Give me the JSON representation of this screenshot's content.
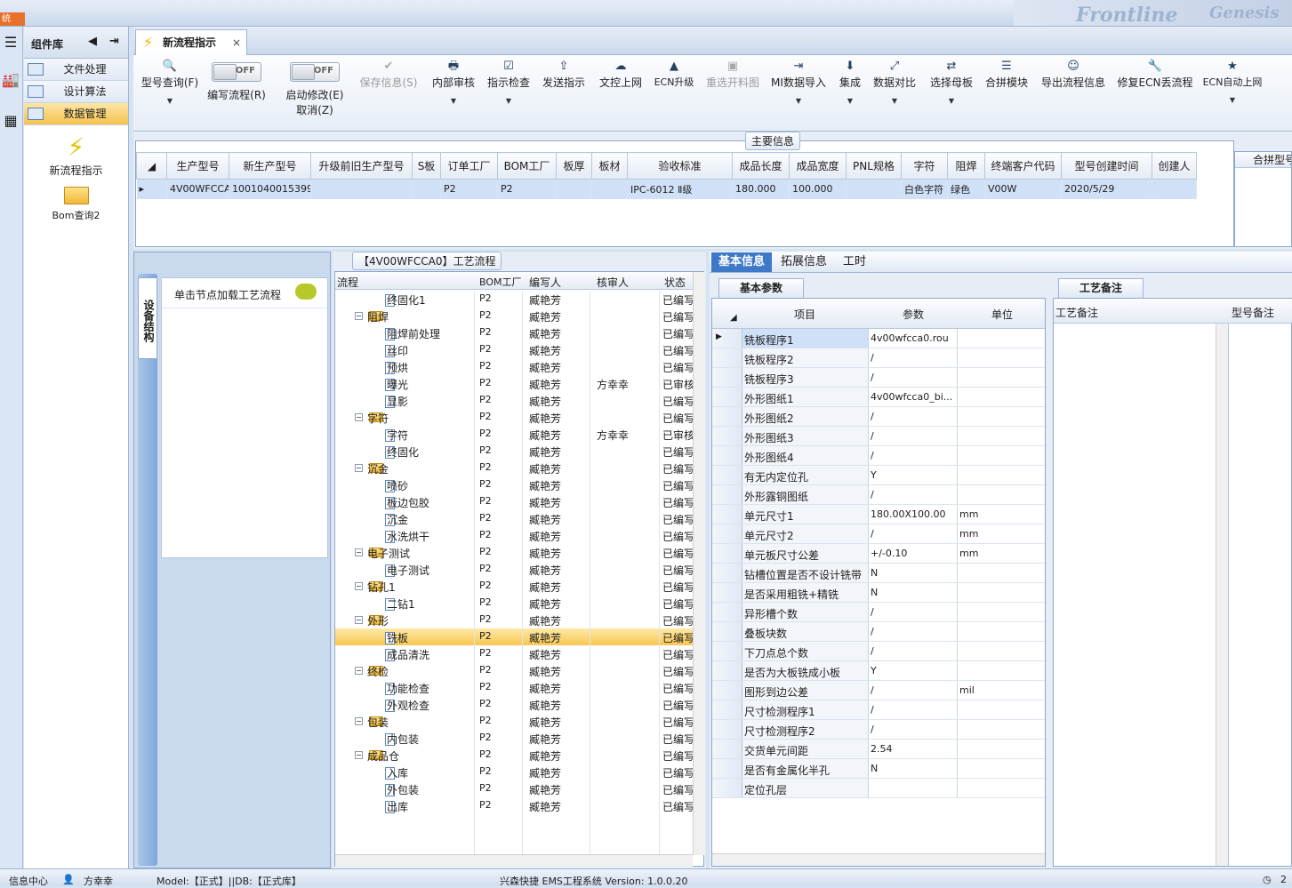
{
  "topbar": {
    "corner_label": "统",
    "brand_text": "Frontline",
    "brand_text2": "Genesis"
  },
  "sidebar": {
    "title": "组件库",
    "items": [
      {
        "label": "文件处理"
      },
      {
        "label": "设计算法"
      },
      {
        "label": "数据管理"
      }
    ],
    "tiles": [
      {
        "label": "新流程指示"
      },
      {
        "label": "Bom查询2"
      }
    ]
  },
  "tab": {
    "label": "新流程指示",
    "close": "×"
  },
  "toolbar": {
    "toggle_off": "OFF",
    "buttons": [
      {
        "label": "型号查询(F)",
        "icon": "search-icon",
        "glyph": "🔍"
      },
      {
        "label": "编写流程(R)"
      },
      {
        "label": "启动修改(E)",
        "label2": "取消(Z)"
      },
      {
        "label": "保存信息(S)",
        "glyph": "✔"
      },
      {
        "label": "内部审核",
        "glyph": "🖶"
      },
      {
        "label": "指示检查",
        "glyph": "☑"
      },
      {
        "label": "发送指示",
        "glyph": "⇪"
      },
      {
        "label": "文控上网",
        "glyph": "☁"
      },
      {
        "label": "ECN升级",
        "glyph": "▲"
      },
      {
        "label": "重选开料图",
        "glyph": "▣"
      },
      {
        "label": "MI数据导入",
        "glyph": "⇥"
      },
      {
        "label": "集成",
        "glyph": "⬇"
      },
      {
        "label": "数据对比",
        "glyph": "⤢"
      },
      {
        "label": "选择母板",
        "glyph": "⇄"
      },
      {
        "label": "合拼模块",
        "glyph": "☰"
      },
      {
        "label": "导出流程信息",
        "glyph": "☺"
      },
      {
        "label": "修复ECN丢流程",
        "glyph": "🔧"
      },
      {
        "label": "ECN自动上网",
        "glyph": "★"
      }
    ]
  },
  "main_info": {
    "group_title": "主要信息",
    "right_title": "合拼型号",
    "columns": [
      "生产型号",
      "新生产型号",
      "升级前旧生产型号",
      "S板",
      "订单工厂",
      "BOM工厂",
      "板厚",
      "板材",
      "验收标准",
      "成品长度",
      "成品宽度",
      "PNL规格",
      "字符",
      "阻焊",
      "终端客户代码",
      "型号创建时间",
      "创建人"
    ],
    "row": [
      "4V00WFCCA0",
      "10010400153993",
      "",
      "",
      "P2",
      "P2",
      "",
      "",
      "IPC-6012 Ⅱ级",
      "180.000",
      "100.000",
      "",
      "白色字符",
      "绿色",
      "V00W",
      "2020/5/29",
      ""
    ]
  },
  "side_tab": {
    "label": "设备结构",
    "hint": "单击节点加载工艺流程"
  },
  "flow": {
    "title": "【4V00WFCCA0】工艺流程",
    "columns": [
      "流程",
      "BOM工厂",
      "编写人",
      "核审人",
      "状态"
    ],
    "rows": [
      {
        "name": "终固化1",
        "level": 2,
        "factory": "P2",
        "writer": "臧艳芳",
        "reviewer": "",
        "status": "已编写"
      },
      {
        "name": "阻焊",
        "level": 1,
        "factory": "P2",
        "writer": "臧艳芳",
        "reviewer": "",
        "status": "已编写"
      },
      {
        "name": "阻焊前处理",
        "level": 2,
        "factory": "P2",
        "writer": "臧艳芳",
        "reviewer": "",
        "status": "已编写"
      },
      {
        "name": "丝印",
        "level": 2,
        "factory": "P2",
        "writer": "臧艳芳",
        "reviewer": "",
        "status": "已编写"
      },
      {
        "name": "预烘",
        "level": 2,
        "factory": "P2",
        "writer": "臧艳芳",
        "reviewer": "",
        "status": "已编写"
      },
      {
        "name": "曝光",
        "level": 2,
        "factory": "P2",
        "writer": "臧艳芳",
        "reviewer": "方幸幸",
        "status": "已审核"
      },
      {
        "name": "显影",
        "level": 2,
        "factory": "P2",
        "writer": "臧艳芳",
        "reviewer": "",
        "status": "已编写"
      },
      {
        "name": "字符",
        "level": 1,
        "factory": "P2",
        "writer": "臧艳芳",
        "reviewer": "",
        "status": "已编写"
      },
      {
        "name": "字符",
        "level": 2,
        "factory": "P2",
        "writer": "臧艳芳",
        "reviewer": "方幸幸",
        "status": "已审核"
      },
      {
        "name": "终固化",
        "level": 2,
        "factory": "P2",
        "writer": "臧艳芳",
        "reviewer": "",
        "status": "已编写"
      },
      {
        "name": "沉金",
        "level": 1,
        "factory": "P2",
        "writer": "臧艳芳",
        "reviewer": "",
        "status": "已编写"
      },
      {
        "name": "喷砂",
        "level": 2,
        "factory": "P2",
        "writer": "臧艳芳",
        "reviewer": "",
        "status": "已编写"
      },
      {
        "name": "板边包胶",
        "level": 2,
        "factory": "P2",
        "writer": "臧艳芳",
        "reviewer": "",
        "status": "已编写"
      },
      {
        "name": "沉金",
        "level": 2,
        "factory": "P2",
        "writer": "臧艳芳",
        "reviewer": "",
        "status": "已编写"
      },
      {
        "name": "水洗烘干",
        "level": 2,
        "factory": "P2",
        "writer": "臧艳芳",
        "reviewer": "",
        "status": "已编写"
      },
      {
        "name": "电子测试",
        "level": 1,
        "factory": "P2",
        "writer": "臧艳芳",
        "reviewer": "",
        "status": "已编写"
      },
      {
        "name": "电子测试",
        "level": 2,
        "factory": "P2",
        "writer": "臧艳芳",
        "reviewer": "",
        "status": "已编写"
      },
      {
        "name": "钻孔1",
        "level": 1,
        "factory": "P2",
        "writer": "臧艳芳",
        "reviewer": "",
        "status": "已编写"
      },
      {
        "name": "二钻1",
        "level": 2,
        "factory": "P2",
        "writer": "臧艳芳",
        "reviewer": "",
        "status": "已编写"
      },
      {
        "name": "外形",
        "level": 1,
        "factory": "P2",
        "writer": "臧艳芳",
        "reviewer": "",
        "status": "已编写"
      },
      {
        "name": "铣板",
        "level": 2,
        "factory": "P2",
        "writer": "臧艳芳",
        "reviewer": "",
        "status": "已编写",
        "selected": true
      },
      {
        "name": "成品清洗",
        "level": 2,
        "factory": "P2",
        "writer": "臧艳芳",
        "reviewer": "",
        "status": "已编写"
      },
      {
        "name": "终检",
        "level": 1,
        "factory": "P2",
        "writer": "臧艳芳",
        "reviewer": "",
        "status": "已编写"
      },
      {
        "name": "功能检查",
        "level": 2,
        "factory": "P2",
        "writer": "臧艳芳",
        "reviewer": "",
        "status": "已编写"
      },
      {
        "name": "外观检查",
        "level": 2,
        "factory": "P2",
        "writer": "臧艳芳",
        "reviewer": "",
        "status": "已编写"
      },
      {
        "name": "包装",
        "level": 1,
        "factory": "P2",
        "writer": "臧艳芳",
        "reviewer": "",
        "status": "已编写"
      },
      {
        "name": "内包装",
        "level": 2,
        "factory": "P2",
        "writer": "臧艳芳",
        "reviewer": "",
        "status": "已编写"
      },
      {
        "name": "成品仓",
        "level": 1,
        "factory": "P2",
        "writer": "臧艳芳",
        "reviewer": "",
        "status": "已编写"
      },
      {
        "name": "入库",
        "level": 2,
        "factory": "P2",
        "writer": "臧艳芳",
        "reviewer": "",
        "status": "已编写"
      },
      {
        "name": "外包装",
        "level": 2,
        "factory": "P2",
        "writer": "臧艳芳",
        "reviewer": "",
        "status": "已编写"
      },
      {
        "name": "出库",
        "level": 2,
        "factory": "P2",
        "writer": "臧艳芳",
        "reviewer": "",
        "status": "已编写"
      }
    ]
  },
  "detail_tabs": [
    "基本信息",
    "拓展信息",
    "工时"
  ],
  "params": {
    "tab": "基本参数",
    "columns": [
      "项目",
      "参数",
      "单位"
    ],
    "rows": [
      {
        "item": "铣板程序1",
        "value": "4v00wfcca0.rou",
        "unit": ""
      },
      {
        "item": "铣板程序2",
        "value": "/",
        "unit": ""
      },
      {
        "item": "铣板程序3",
        "value": "/",
        "unit": ""
      },
      {
        "item": "外形图纸1",
        "value": "4v00wfcca0_bi...",
        "unit": ""
      },
      {
        "item": "外形图纸2",
        "value": "/",
        "unit": ""
      },
      {
        "item": "外形图纸3",
        "value": "/",
        "unit": ""
      },
      {
        "item": "外形图纸4",
        "value": "/",
        "unit": ""
      },
      {
        "item": "有无内定位孔",
        "value": "Y",
        "unit": ""
      },
      {
        "item": "外形露铜图纸",
        "value": "/",
        "unit": ""
      },
      {
        "item": "单元尺寸1",
        "value": "180.00X100.00",
        "unit": "mm"
      },
      {
        "item": "单元尺寸2",
        "value": "/",
        "unit": "mm"
      },
      {
        "item": "单元板尺寸公差",
        "value": "+/-0.10",
        "unit": "mm"
      },
      {
        "item": "钻槽位置是否不设计铣带",
        "value": "N",
        "unit": ""
      },
      {
        "item": "是否采用粗铣+精铣",
        "value": "N",
        "unit": ""
      },
      {
        "item": "异形槽个数",
        "value": "/",
        "unit": ""
      },
      {
        "item": "叠板块数",
        "value": "/",
        "unit": ""
      },
      {
        "item": "下刀点总个数",
        "value": "/",
        "unit": ""
      },
      {
        "item": "是否为大板铣成小板",
        "value": "Y",
        "unit": ""
      },
      {
        "item": "图形到边公差",
        "value": "/",
        "unit": "mil"
      },
      {
        "item": "尺寸检测程序1",
        "value": "/",
        "unit": ""
      },
      {
        "item": "尺寸检测程序2",
        "value": "/",
        "unit": ""
      },
      {
        "item": "交货单元间距",
        "value": "2.54",
        "unit": ""
      },
      {
        "item": "是否有金属化半孔",
        "value": "N",
        "unit": ""
      },
      {
        "item": "定位孔层",
        "value": "",
        "unit": ""
      }
    ]
  },
  "notes": {
    "tab": "工艺备注",
    "col1": "工艺备注",
    "col2": "型号备注"
  },
  "status": {
    "info_center": "信息中心",
    "user": "方幸幸",
    "model": "Model:【正式】||DB:【正式库】",
    "app": "兴森快捷 EMS工程系统 Version: 1.0.0.20",
    "right": "2"
  }
}
